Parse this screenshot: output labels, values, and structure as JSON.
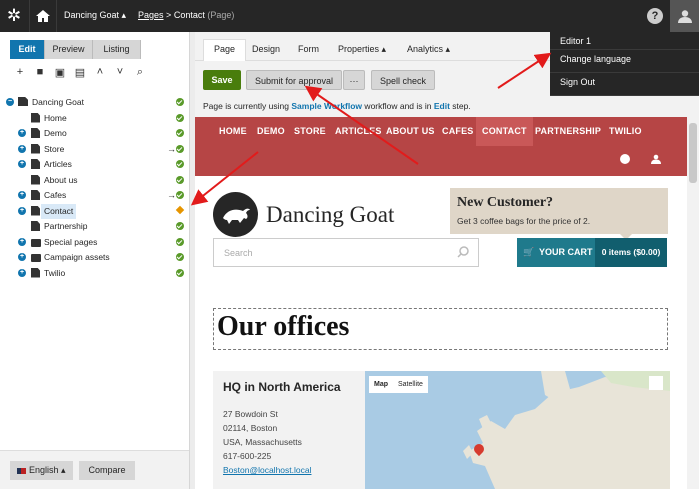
{
  "topbar": {
    "site_name": "Dancing Goat",
    "breadcrumb_pages": "Pages",
    "breadcrumb_sep": ">",
    "breadcrumb_current": "Contact",
    "breadcrumb_type": "(Page)",
    "help": "?"
  },
  "user_menu": {
    "items": [
      "Editor 1",
      "Change language",
      "Sign Out"
    ]
  },
  "left_panel": {
    "modes": [
      "Edit",
      "Preview",
      "Listing"
    ],
    "tree": [
      {
        "label": "Dancing Goat",
        "status": "ok"
      },
      {
        "label": "Home",
        "status": "ok"
      },
      {
        "label": "Demo",
        "status": "ok"
      },
      {
        "label": "Store",
        "status": "ok",
        "arrow": "→"
      },
      {
        "label": "Articles",
        "status": "ok"
      },
      {
        "label": "About us",
        "status": "ok"
      },
      {
        "label": "Cafes",
        "status": "ok",
        "arrow": "→"
      },
      {
        "label": "Contact",
        "status": "warn"
      },
      {
        "label": "Partnership",
        "status": "ok"
      },
      {
        "label": "Special pages",
        "status": "ok"
      },
      {
        "label": "Campaign assets",
        "status": "ok"
      },
      {
        "label": "Twilio",
        "status": "ok"
      }
    ],
    "language": "English",
    "compare": "Compare"
  },
  "editor": {
    "tabs": [
      "Page",
      "Design",
      "Form",
      "Properties",
      "Analytics"
    ],
    "save": "Save",
    "submit": "Submit for approval",
    "more": "···",
    "spell": "Spell check",
    "workflow_msg_pre": "Page is currently using ",
    "workflow_name": "Sample Workflow",
    "workflow_msg_mid": " workflow and is in ",
    "workflow_step": "Edit",
    "workflow_msg_post": " step."
  },
  "site": {
    "nav": [
      "HOME",
      "DEMO",
      "STORE",
      "ARTICLES",
      "ABOUT US",
      "CAFES",
      "CONTACT",
      "PARTNERSHIP",
      "TWILIO"
    ],
    "brand": "Dancing Goat",
    "promo_title": "New Customer?",
    "promo_text": "Get 3 coffee bags for the price of 2.",
    "search_placeholder": "Search",
    "cart": "YOUR CART",
    "cart_items": "0 items ($0.00)",
    "heading": "Our offices",
    "office_title": "HQ in North America",
    "address1": "27 Bowdoin St",
    "address2": "02114, Boston",
    "address3": "USA, Massachusetts",
    "phone": "617-600-225",
    "email": "Boston@localhost.local",
    "map_btn_map": "Map",
    "map_btn_sat": "Satellite"
  },
  "colors": {
    "accent": "#1175ae",
    "save": "#497d0c",
    "nav": "#b64545",
    "arrow": "#e21b1b"
  }
}
